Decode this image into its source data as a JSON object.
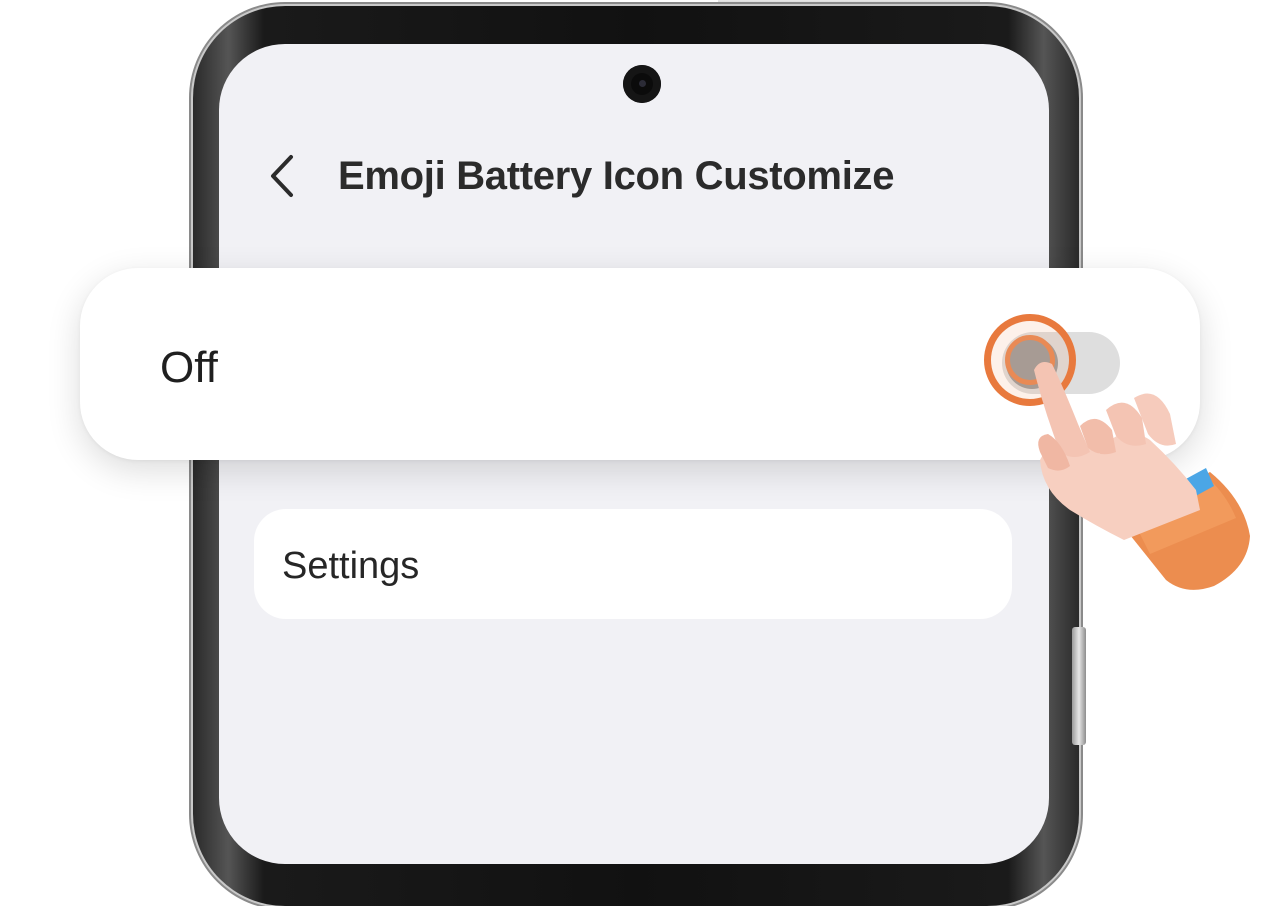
{
  "header": {
    "back_icon": "chevron-left-icon",
    "title": "Emoji Battery Icon Customize"
  },
  "toggle_row": {
    "label": "Off",
    "state": "off",
    "accent_color": "#E8793D"
  },
  "settings_row": {
    "label": "Settings"
  },
  "illustration": {
    "hand_icon": "pointing-hand-icon",
    "tap_indicator": "tap-ring-icon"
  },
  "colors": {
    "screen_bg": "#F1F1F5",
    "card_bg": "#FFFFFF",
    "accent": "#E8793D"
  }
}
